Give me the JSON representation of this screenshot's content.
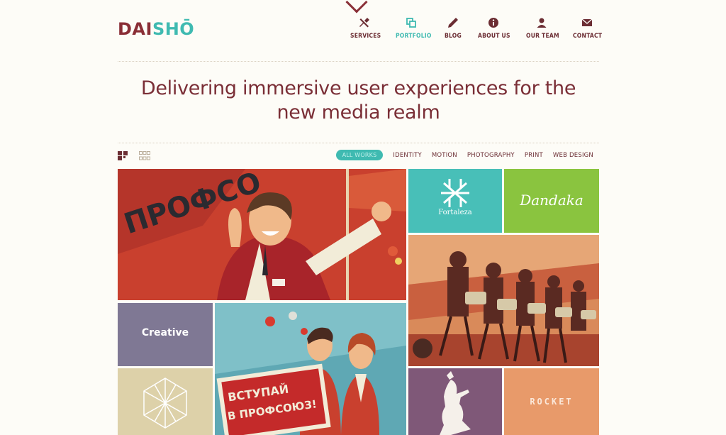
{
  "brand": {
    "logo_part1": "DAI",
    "logo_part2": "SHŌ",
    "accent": "#3fbab1",
    "primary": "#7a2e36"
  },
  "nav": [
    {
      "label": "SERVICES",
      "icon": "tools-icon"
    },
    {
      "label": "PORTFOLIO",
      "icon": "windows-icon",
      "active": true
    },
    {
      "label": "BLOG",
      "icon": "pencil-icon"
    },
    {
      "label": "ABOUT US",
      "icon": "info-icon"
    },
    {
      "label": "OUR TEAM",
      "icon": "user-icon"
    },
    {
      "label": "CONTACT",
      "icon": "envelope-icon"
    }
  ],
  "hero": {
    "line1": "Delivering immersive user experiences for the",
    "line2": "new media realm"
  },
  "filters": [
    "ALL WORKS",
    "IDENTITY",
    "MOTION",
    "PHOTOGRAPHY",
    "PRINT",
    "WEB DESIGN"
  ],
  "portfolio": {
    "fortaleza_label": "Fortaleza",
    "dandaka_label": "Dandaka",
    "creative_label": "Creative",
    "rocket_label": "ROCKET",
    "poster_text_1": "ВСТУПАЙ",
    "poster_text_2": "В ПРОФСОЮЗ!",
    "banner_text": "ПРОФСО"
  }
}
